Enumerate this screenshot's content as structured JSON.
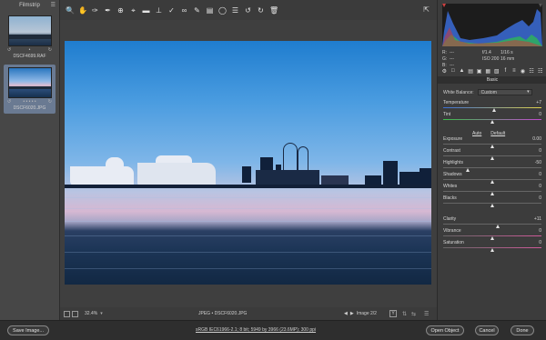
{
  "filmstrip": {
    "title": "Filmstrip",
    "items": [
      {
        "name": "DSCF4699.RAF",
        "selected": false
      },
      {
        "name": "DSCF6020.JPG",
        "selected": true
      }
    ]
  },
  "canvas_bar": {
    "zoom": "32.4%",
    "format": "JPEG • DSCF6020.JPG",
    "image_count": "Image 2/2",
    "y_label": "Y"
  },
  "camera_info": {
    "r": "R:",
    "g": "G:",
    "b": "B:",
    "dash": "---",
    "aperture": "f/1.4",
    "shutter": "1/16 s",
    "iso": "ISO 200",
    "focal": "16 mm"
  },
  "panel": {
    "section": "Basic",
    "white_balance_label": "White Balance:",
    "white_balance_value": "Custom",
    "auto": "Auto",
    "default": "Default",
    "sliders": [
      {
        "label": "Temperature",
        "value": "+7",
        "level": 0.52
      },
      {
        "label": "Tint",
        "value": "0",
        "level": 0.5
      },
      {
        "label": "Exposure",
        "value": "0.00",
        "level": 0.5
      },
      {
        "label": "Contrast",
        "value": "0",
        "level": 0.5
      },
      {
        "label": "Highlights",
        "value": "-50",
        "level": 0.25
      },
      {
        "label": "Shadows",
        "value": "0",
        "level": 0.5
      },
      {
        "label": "Whites",
        "value": "0",
        "level": 0.5
      },
      {
        "label": "Blacks",
        "value": "0",
        "level": 0.5
      },
      {
        "label": "Clarity",
        "value": "+11",
        "level": 0.56
      },
      {
        "label": "Vibrance",
        "value": "0",
        "level": 0.5
      },
      {
        "label": "Saturation",
        "value": "0",
        "level": 0.5
      }
    ]
  },
  "bottom": {
    "save_image": "Save Image...",
    "workflow_link": "sRGB IEC61966-2.1; 8 bit; 5949 by 3966 (23.6MP); 300 ppi",
    "open_object": "Open Object",
    "cancel": "Cancel",
    "done": "Done"
  }
}
